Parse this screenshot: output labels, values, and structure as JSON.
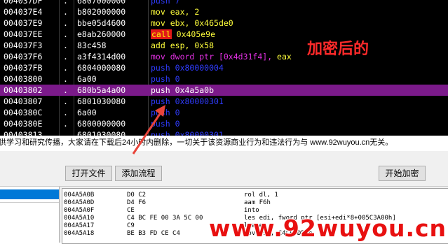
{
  "debugger": {
    "rows": [
      {
        "addr": "004037DF",
        "dot": ".",
        "hex": "6807000000",
        "mn": "push",
        "op": "7",
        "kind": "push"
      },
      {
        "addr": "004037E4",
        "dot": ".",
        "hex": "b802000000",
        "mn": "mov",
        "op": "eax, 2",
        "kind": "mov"
      },
      {
        "addr": "004037E9",
        "dot": ".",
        "hex": "bbe05d4600",
        "mn": "mov",
        "op": "ebx, 0x465de0",
        "kind": "mov"
      },
      {
        "addr": "004037EE",
        "dot": ".",
        "hex": "e8ab260000",
        "mn": "call",
        "op": "0x405e9e",
        "kind": "call"
      },
      {
        "addr": "004037F3",
        "dot": ".",
        "hex": "83c458",
        "mn": "add",
        "op": "esp, 0x58",
        "kind": "add"
      },
      {
        "addr": "004037F6",
        "dot": ".",
        "hex": "a3f4314d00",
        "mn": "mov",
        "op": "dword ptr [0x4d31f4],",
        "reg": " eax",
        "kind": "movptr"
      },
      {
        "addr": "004037FB",
        "dot": ".",
        "hex": "6804000080",
        "mn": "push",
        "op": "0x80000004",
        "kind": "push"
      },
      {
        "addr": "00403800",
        "dot": ".",
        "hex": "6a00",
        "mn": "push",
        "op": "0",
        "kind": "push"
      },
      {
        "addr": "00403802",
        "dot": ".",
        "hex": "680b5a4a00",
        "mn": "push",
        "op": "0x4a5a0b",
        "kind": "push",
        "selected": true
      },
      {
        "addr": "00403807",
        "dot": ".",
        "hex": "6801030080",
        "mn": "push",
        "op": "0x80000301",
        "kind": "push"
      },
      {
        "addr": "0040380C",
        "dot": ".",
        "hex": "6a00",
        "mn": "push",
        "op": "0",
        "kind": "push"
      },
      {
        "addr": "0040380E",
        "dot": ".",
        "hex": "6800000000",
        "mn": "push",
        "op": "0",
        "kind": "push"
      },
      {
        "addr": "00403813",
        "dot": ".",
        "hex": "6801030080",
        "mn": "push",
        "op": "0x80000301",
        "kind": "push"
      }
    ],
    "annotation": "加密后的"
  },
  "notice": "供学习和研究传播，大家请在下载后24小时内删除，一切关于该资源商业行为和违法行为与 www.92wuyou.cn无关。",
  "toolbar": {
    "open_file": "打开文件",
    "add_flow": "添加流程",
    "start_encrypt": "开始加密"
  },
  "disasm": [
    {
      "addr": "004A5A0B",
      "hex": "D0 C2",
      "asm": "rol dl, 1"
    },
    {
      "addr": "004A5A0D",
      "hex": "D4 F6",
      "asm": "aam F6h"
    },
    {
      "addr": "004A5A0F",
      "hex": "CE",
      "asm": "into"
    },
    {
      "addr": "004A5A10",
      "hex": "C4 BC FE 00 3A 5C 00",
      "asm": "les edi, fword ptr [esi+edi*8+005C3A00h]"
    },
    {
      "addr": "004A5A17",
      "hex": "C9",
      "asm": "leave"
    },
    {
      "addr": "004A5A18",
      "hex": "BE B3 FD CE C4",
      "asm": "mov esi, C4CEFDB3h"
    }
  ],
  "watermark": "www.92wuyou.cn",
  "colors": {
    "selected_row": "#7b1a8a",
    "push": "#2f3cff",
    "mov": "#ffff3c",
    "call_bg": "#e01818",
    "annotation": "#ff2a2a"
  }
}
